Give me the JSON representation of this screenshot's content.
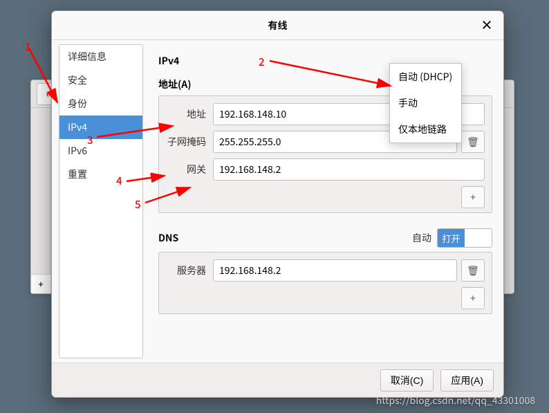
{
  "dialog": {
    "title": "有线",
    "close": "×"
  },
  "sidebar": {
    "items": [
      {
        "label": "详细信息"
      },
      {
        "label": "安全"
      },
      {
        "label": "身份"
      },
      {
        "label": "IPv4",
        "selected": true
      },
      {
        "label": "IPv6"
      },
      {
        "label": "重置"
      }
    ]
  },
  "ipv4": {
    "heading": "IPv4",
    "address_heading": "地址(A)",
    "rows": {
      "addr_label": "地址",
      "addr_value": "192.168.148.10",
      "mask_label": "子网掩码",
      "mask_value": "255.255.255.0",
      "gw_label": "网关",
      "gw_value": "192.168.148.2"
    },
    "add": "+",
    "trash": "🗑"
  },
  "dns": {
    "heading": "DNS",
    "auto_label": "自动",
    "switch_on": "打开",
    "server_label": "服务器",
    "server_value": "192.168.148.2",
    "add": "+",
    "trash": "🗑"
  },
  "dropdown": {
    "items": [
      {
        "label": "自动 (DHCP)"
      },
      {
        "label": "手动"
      },
      {
        "label": "仅本地链路"
      }
    ]
  },
  "footer": {
    "cancel": "取消(C)",
    "apply": "应用(A)"
  },
  "annotations": {
    "n1": "1",
    "n2": "2",
    "n3": "3",
    "n4": "4",
    "n5": "5"
  },
  "background": {
    "back": "‹",
    "close": "×",
    "plus": "+",
    "gear": "⚙"
  },
  "watermark": "https://blog.csdn.net/qq_43301008"
}
